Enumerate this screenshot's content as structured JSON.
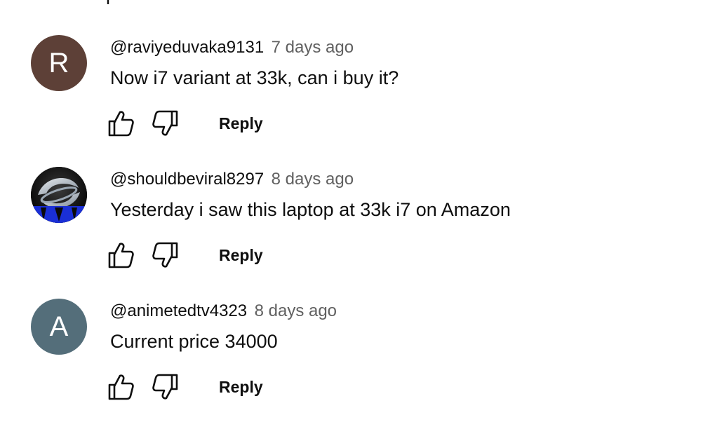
{
  "comments": [
    {
      "author": "@raviyeduvaka9131",
      "time": "7 days ago",
      "text": "Now i7 variant at 33k, can i buy it?",
      "avatar_letter": "R",
      "avatar_color": "#5d4037",
      "reply_label": "Reply"
    },
    {
      "author": "@shouldbeviral8297",
      "time": "8 days ago",
      "text": "Yesterday i saw this laptop at 33k i7 on Amazon",
      "avatar_letter": "",
      "avatar_color": "#0a0a0a",
      "reply_label": "Reply"
    },
    {
      "author": "@animetedtv4323",
      "time": "8 days ago",
      "text": "Current price 34000",
      "avatar_letter": "A",
      "avatar_color": "#546e7a",
      "reply_label": "Reply"
    }
  ],
  "icons": {
    "like": "thumbs-up-icon",
    "dislike": "thumbs-down-icon"
  }
}
